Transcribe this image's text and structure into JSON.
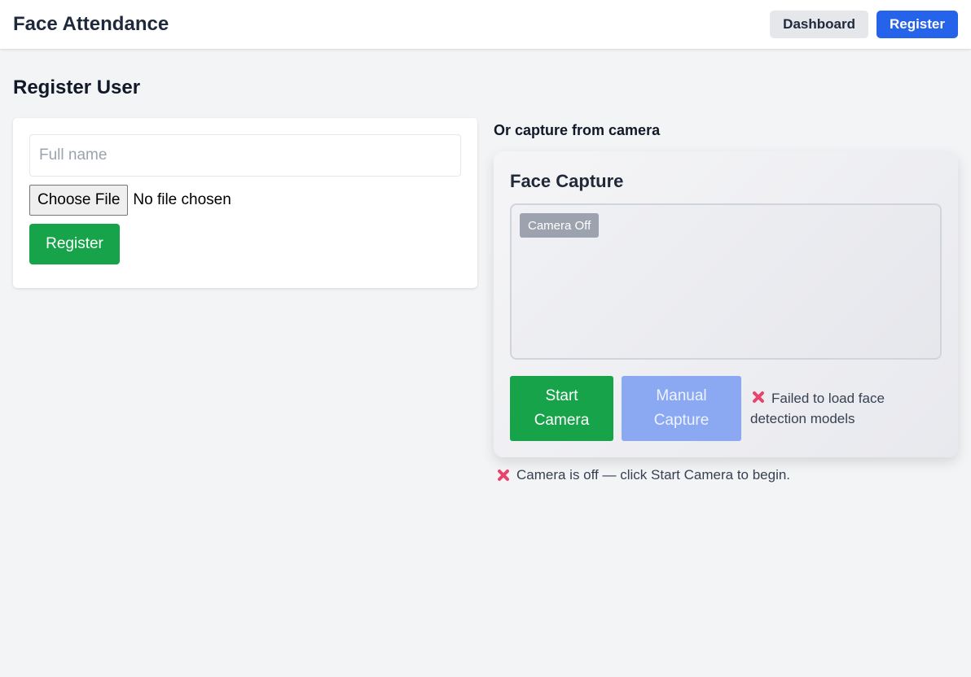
{
  "header": {
    "title": "Face Attendance",
    "nav": {
      "dashboard_label": "Dashboard",
      "register_label": "Register"
    }
  },
  "page": {
    "title": "Register User"
  },
  "form": {
    "name_placeholder": "Full name",
    "name_value": "",
    "file_button_label": "Choose File",
    "file_status": "No file chosen",
    "submit_label": "Register"
  },
  "capture": {
    "heading": "Or capture from camera",
    "card_title": "Face Capture",
    "camera_badge": "Camera Off",
    "start_label": "Start Camera",
    "manual_label": "Manual Capture",
    "model_status": "Failed to load face detection models",
    "camera_status": "Camera is off — click Start Camera to begin.",
    "error_icon": "x-mark-icon"
  },
  "colors": {
    "primary": "#2563eb",
    "success": "#16a34a",
    "disabled": "#8aa9f2",
    "error": "#e7446e",
    "background": "#f3f4f6"
  }
}
